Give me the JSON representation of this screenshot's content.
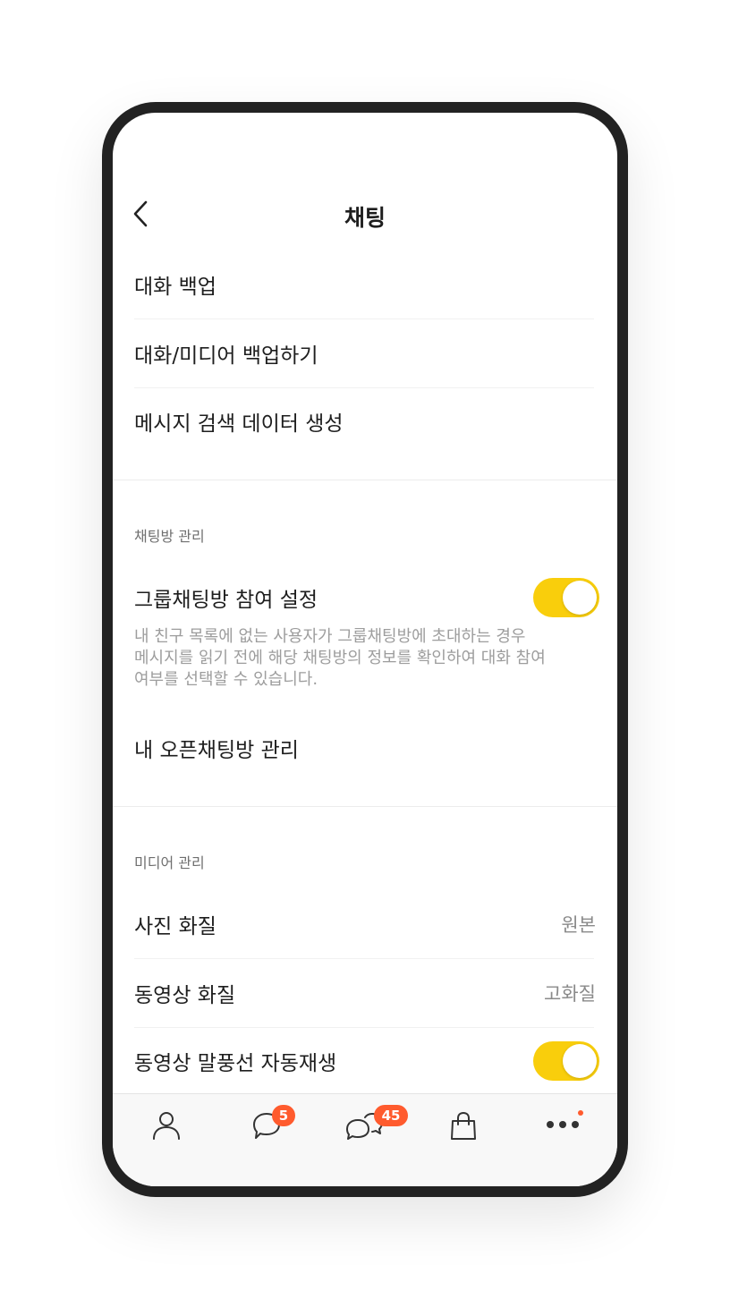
{
  "header": {
    "title": "채팅"
  },
  "backup": {
    "items": [
      {
        "label": "대화 백업"
      },
      {
        "label": "대화/미디어 백업하기"
      },
      {
        "label": "메시지 검색 데이터 생성"
      }
    ]
  },
  "chatroom": {
    "section_title": "채팅방 관리",
    "group_setting": {
      "label": "그룹채팅방 참여 설정",
      "enabled": true,
      "description_lines": [
        "내 친구 목록에 없는 사용자가 그룹채팅방에 초대하는 경우",
        "메시지를 읽기 전에 해당 채팅방의 정보를 확인하여 대화 참여",
        "여부를 선택할 수 있습니다."
      ]
    },
    "open_chat": {
      "label": "내 오픈채팅방 관리"
    }
  },
  "media": {
    "section_title": "미디어 관리",
    "photo_quality": {
      "label": "사진 화질",
      "value": "원본"
    },
    "video_quality": {
      "label": "동영상 화질",
      "value": "고화질"
    },
    "video_autoplay": {
      "label": "동영상 말풍선 자동재생",
      "enabled": true
    }
  },
  "tabbar": {
    "friends": {
      "icon": "person-icon"
    },
    "chats": {
      "icon": "chat-bubble-icon",
      "badge": "5"
    },
    "openchat": {
      "icon": "open-chat-icon",
      "badge": "45"
    },
    "shopping": {
      "icon": "shopping-bag-icon"
    },
    "more": {
      "icon": "more-icon"
    }
  },
  "colors": {
    "toggle_on": "#f9ce0c",
    "badge": "#ff5b2e"
  }
}
